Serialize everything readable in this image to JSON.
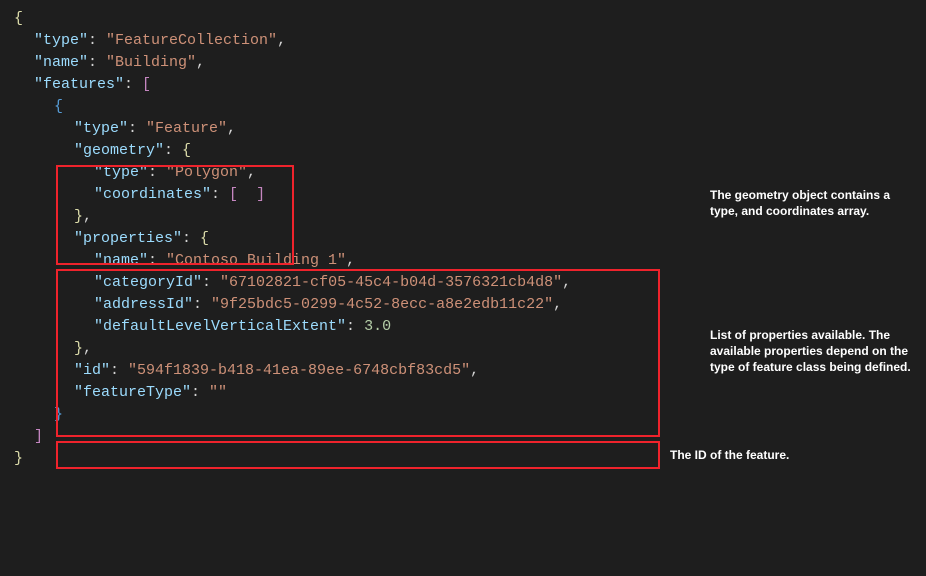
{
  "code": {
    "root_type_key": "\"type\"",
    "root_type_val": "\"FeatureCollection\"",
    "root_name_key": "\"name\"",
    "root_name_val": "\"Building\"",
    "features_key": "\"features\"",
    "feat_type_key": "\"type\"",
    "feat_type_val": "\"Feature\"",
    "geometry_key": "\"geometry\"",
    "geom_type_key": "\"type\"",
    "geom_type_val": "\"Polygon\"",
    "coords_key": "\"coordinates\"",
    "properties_key": "\"properties\"",
    "prop_name_key": "\"name\"",
    "prop_name_val": "\"Contoso Building 1\"",
    "prop_cat_key": "\"categoryId\"",
    "prop_cat_val": "\"67102821-cf05-45c4-b04d-3576321cb4d8\"",
    "prop_addr_key": "\"addressId\"",
    "prop_addr_val": "\"9f25bdc5-0299-4c52-8ecc-a8e2edb11c22\"",
    "prop_dlve_key": "\"defaultLevelVerticalExtent\"",
    "prop_dlve_val": "3.0",
    "id_key": "\"id\"",
    "id_val": "\"594f1839-b418-41ea-89ee-6748cbf83cd5\"",
    "ftype_key": "\"featureType\"",
    "ftype_val": "\"\""
  },
  "annotations": {
    "geometry": "The geometry object contains a type, and coordinates array.",
    "properties": "List of properties available. The available properties depend on the type of feature class being defined.",
    "id": "The ID of the feature."
  }
}
